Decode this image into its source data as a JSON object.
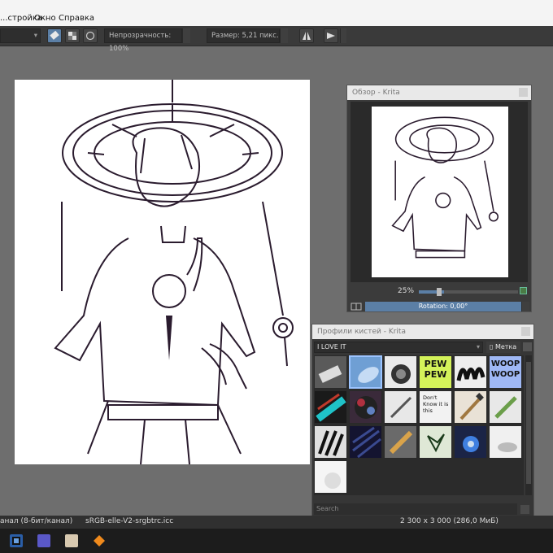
{
  "menubar": {
    "items": [
      "...стройка",
      "Окно",
      "Справка"
    ]
  },
  "toolbar": {
    "opacity_label": "Непрозрачность: 100%",
    "size_label": "Размер: 5,21 пикс."
  },
  "overview": {
    "title": "Обзор - Krita",
    "zoom_label": "25%",
    "zoom_level": 0.25,
    "rotation_label": "Rotation: 0,00°"
  },
  "brushes": {
    "title": "Профили кистей - Krita",
    "tag_selected": "I LOVE IT",
    "label_button": "Метка",
    "search_placeholder": "Search",
    "preset_texts": [
      "PEW PEW",
      "WOOP WOOP",
      "Don't Know it is this"
    ]
  },
  "statusbar": {
    "color_channel": "анал (8-бит/канал)",
    "color_profile": "sRGB-elle-V2-srgbtrc.icc",
    "image_size": "2 300 x 3 000 (286,0 МиБ)"
  },
  "colors": {
    "accent": "#5b7fa6",
    "panel": "#363636",
    "canvas": "#ffffff",
    "line_art": "#2a1b2e"
  }
}
